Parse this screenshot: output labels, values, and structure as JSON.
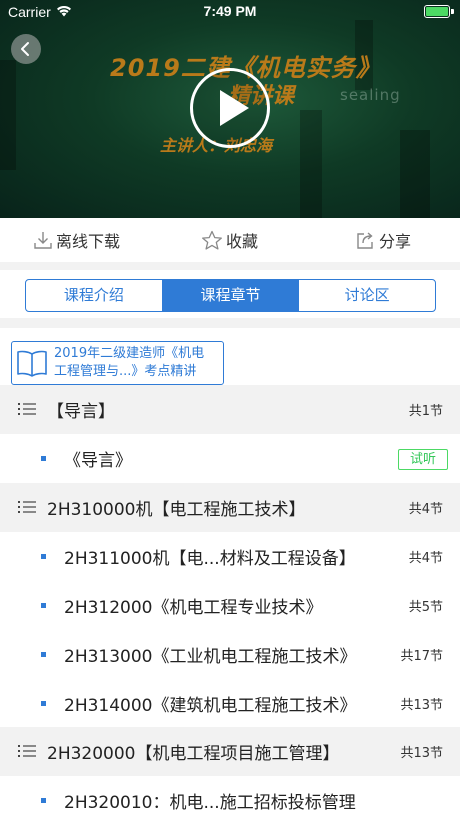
{
  "status_bar": {
    "carrier": "Carrier",
    "time": "7:49 PM"
  },
  "video": {
    "title_line1": "2019二建《机电实务》",
    "title_line2": "精讲课",
    "brand_text": "sealing",
    "presenter": "主讲人：刘忠海",
    "play_icon": "play-icon",
    "back_icon": "chevron-left-icon"
  },
  "actions": [
    {
      "label": "离线下载",
      "icon": "download-icon"
    },
    {
      "label": "收藏",
      "icon": "star-icon"
    },
    {
      "label": "分享",
      "icon": "share-icon"
    }
  ],
  "tabs": [
    {
      "label": "课程介绍",
      "active": false
    },
    {
      "label": "课程章节",
      "active": true
    },
    {
      "label": "讨论区",
      "active": false
    }
  ],
  "book": {
    "line1": "2019年二级建造师《机电",
    "line2": "工程管理与...》考点精讲"
  },
  "rows": [
    {
      "kind": "section",
      "title": "【导言】",
      "count": "共1节"
    },
    {
      "kind": "item",
      "title": "《导言》",
      "badge": "试听"
    },
    {
      "kind": "section",
      "title": "2H310000机【电工程施工技术】",
      "count": "共4节"
    },
    {
      "kind": "item",
      "title": "2H311000机【电...材料及工程设备】",
      "count": "共4节"
    },
    {
      "kind": "item",
      "title": "2H312000《机电工程专业技术》",
      "count": "共5节"
    },
    {
      "kind": "item",
      "title": "2H313000《工业机电工程施工技术》",
      "count": "共17节"
    },
    {
      "kind": "item",
      "title": "2H314000《建筑机电工程施工技术》",
      "count": "共13节"
    },
    {
      "kind": "section",
      "title": "2H320000【机电工程项目施工管理】",
      "count": "共13节"
    },
    {
      "kind": "item",
      "title": "2H320010：机电...施工招标投标管理",
      "count": ""
    }
  ],
  "colors": {
    "accent": "#2f7bd6",
    "trial_green": "#34c759",
    "section_bg": "#f2f2f2",
    "video_title": "#b97a1a"
  }
}
